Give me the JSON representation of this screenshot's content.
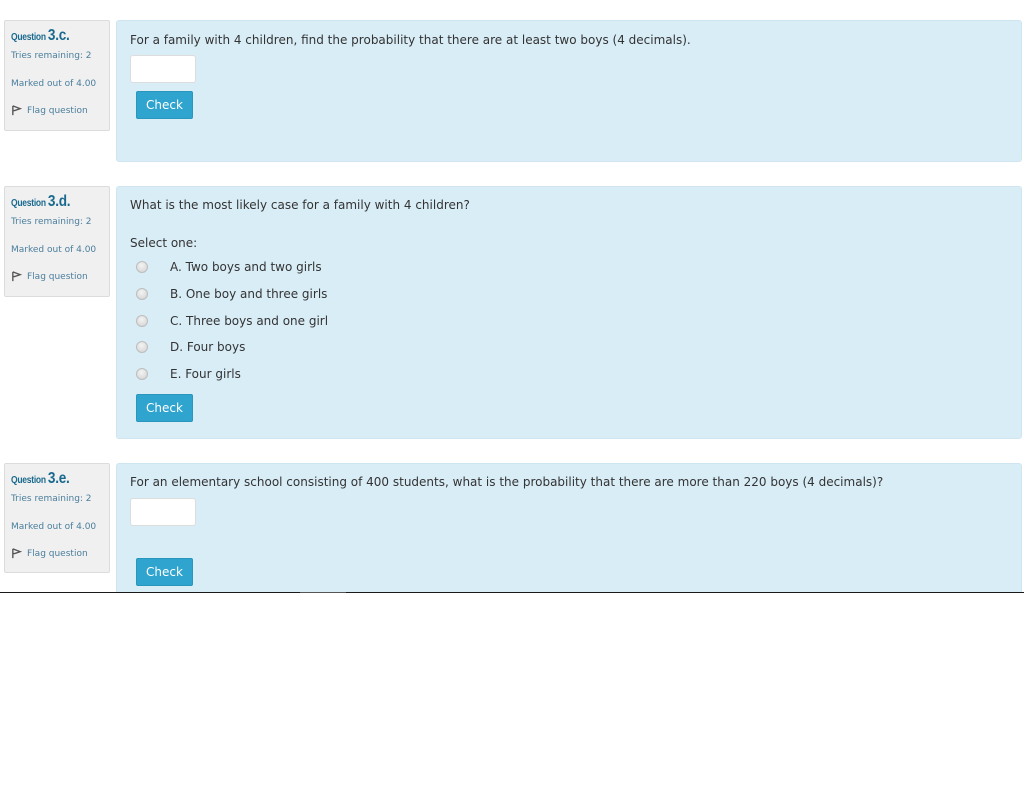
{
  "questions": [
    {
      "label": "Question",
      "number": "3.c.",
      "tries": "Tries remaining: 2",
      "marked": "Marked out of 4.00",
      "flag": "Flag question",
      "text": "For a family with 4 children, find the probability that there are at least two boys (4 decimals).",
      "answer_value": "",
      "check": "Check"
    },
    {
      "label": "Question",
      "number": "3.d.",
      "tries": "Tries remaining: 2",
      "marked": "Marked out of 4.00",
      "flag": "Flag question",
      "text": "What is the most likely case for a family with 4 children?",
      "select_one": "Select one:",
      "options": [
        "A. Two boys and two girls",
        "B. One boy and three girls",
        "C. Three boys and one girl",
        "D. Four boys",
        "E. Four girls"
      ],
      "check": "Check"
    },
    {
      "label": "Question",
      "number": "3.e.",
      "tries": "Tries remaining: 2",
      "marked": "Marked out of 4.00",
      "flag": "Flag question",
      "text": "For an elementary school consisting of 400 students, what is the probability that there are more than 220 boys (4 decimals)?",
      "answer_value": "",
      "check": "Check"
    }
  ],
  "colors": {
    "content_bg": "#d9edf7",
    "info_bg": "#f0f0f0",
    "button": "#2fa4cf",
    "link": "#4a7e9c",
    "question_number": "#1a6a8f"
  }
}
